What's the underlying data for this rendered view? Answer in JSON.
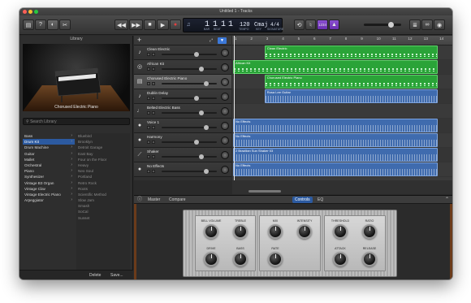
{
  "window": {
    "title": "Untitled 1 - Tracks"
  },
  "toolbar": {
    "lcd": {
      "bar": "1",
      "beat": "1",
      "div": "1",
      "tick": "1",
      "tempo": "120",
      "key": "Cmaj",
      "signature": "4/4",
      "labels": [
        "BAR",
        "BEAT",
        "",
        "",
        "TEMPO",
        "KEY",
        "SIGNATURE"
      ]
    },
    "count_in": "1234"
  },
  "library": {
    "title": "Library",
    "preview_caption": "Chorused Electric Piano",
    "search_placeholder": "Search Library",
    "categories": [
      {
        "label": "Bass",
        "selected": false
      },
      {
        "label": "Drum Kit",
        "selected": true
      },
      {
        "label": "Drum Machine",
        "selected": false
      },
      {
        "label": "Guitar",
        "selected": false
      },
      {
        "label": "Mallet",
        "selected": false
      },
      {
        "label": "Orchestral",
        "selected": false
      },
      {
        "label": "Piano",
        "selected": false
      },
      {
        "label": "Synthesizer",
        "selected": false
      },
      {
        "label": "Vintage B3 Organ",
        "selected": false
      },
      {
        "label": "Vintage Clav",
        "selected": false
      },
      {
        "label": "Vintage Electric Piano",
        "selected": false
      },
      {
        "label": "Arpeggiator",
        "selected": false
      }
    ],
    "patches": [
      "Bluebird",
      "Brooklyn",
      "Detroit Garage",
      "East Bay",
      "Four on the Floor",
      "Heavy",
      "Neo Soul",
      "Portland",
      "Retro Rock",
      "Roots",
      "Scientific Method",
      "Slow Jam",
      "Smash",
      "SoCal",
      "Sunset"
    ],
    "footer": {
      "delete": "Delete",
      "save": "Save..."
    }
  },
  "tracks": [
    {
      "name": "Clean Electric",
      "icon": "guitar",
      "selected": false
    },
    {
      "name": "African Kit",
      "icon": "drums",
      "selected": false
    },
    {
      "name": "Chorused Electric Piano",
      "icon": "keyboard",
      "selected": true
    },
    {
      "name": "Dublin Delay",
      "icon": "guitar",
      "selected": false
    },
    {
      "name": "Belted Electric Bass",
      "icon": "bass",
      "selected": false
    },
    {
      "name": "Voice 1",
      "icon": "mic",
      "selected": false
    },
    {
      "name": "Harmony",
      "icon": "mic",
      "selected": false
    },
    {
      "name": "Shaker",
      "icon": "shaker",
      "selected": false
    },
    {
      "name": "No Effects",
      "icon": "mic",
      "selected": false
    }
  ],
  "regions": [
    {
      "lane": 0,
      "start": 3,
      "end": 13,
      "label": "Clean Electric",
      "kind": "green"
    },
    {
      "lane": 1,
      "start": 1,
      "end": 13,
      "label": "African Kit",
      "kind": "green"
    },
    {
      "lane": 2,
      "start": 3,
      "end": 13,
      "label": "Chorused Electric Piano",
      "kind": "green"
    },
    {
      "lane": 3,
      "start": 3,
      "end": 13,
      "label": "Rosa Lee Guitar",
      "kind": "blue"
    },
    {
      "lane": 5,
      "start": 1,
      "end": 13,
      "label": "No Effects",
      "kind": "blue"
    },
    {
      "lane": 6,
      "start": 1,
      "end": 13,
      "label": "No Effects",
      "kind": "blue"
    },
    {
      "lane": 7,
      "start": 1,
      "end": 13,
      "label": "2 Brazilian Sun Shaker 03",
      "kind": "blue"
    },
    {
      "lane": 8,
      "start": 1,
      "end": 13,
      "label": "No Effects",
      "kind": "blue"
    }
  ],
  "ruler": {
    "bars": [
      "1",
      "2",
      "3",
      "4",
      "5",
      "6",
      "7",
      "8",
      "9",
      "10",
      "11",
      "12",
      "13",
      "14"
    ]
  },
  "editor": {
    "left_tabs": [
      "Master",
      "Compare"
    ],
    "right_tabs": [
      {
        "label": "Controls",
        "active": true
      },
      {
        "label": "EQ",
        "active": false
      }
    ],
    "knobs": [
      {
        "label": "BELL VOLUME"
      },
      {
        "label": "TREBLE"
      },
      {
        "label": "DRIVE"
      },
      {
        "label": "BASS"
      },
      {
        "label": "MIX"
      },
      {
        "label": "INTENSITY"
      },
      {
        "label": "RATE"
      },
      {
        "label": "THRESHOLD"
      },
      {
        "label": "RATIO"
      },
      {
        "label": "ATTACK"
      },
      {
        "label": "RELEASE"
      }
    ]
  },
  "colors": {
    "accent": "#2c5aa0",
    "region_green": "#2aa338",
    "region_blue": "#3f6bae"
  }
}
